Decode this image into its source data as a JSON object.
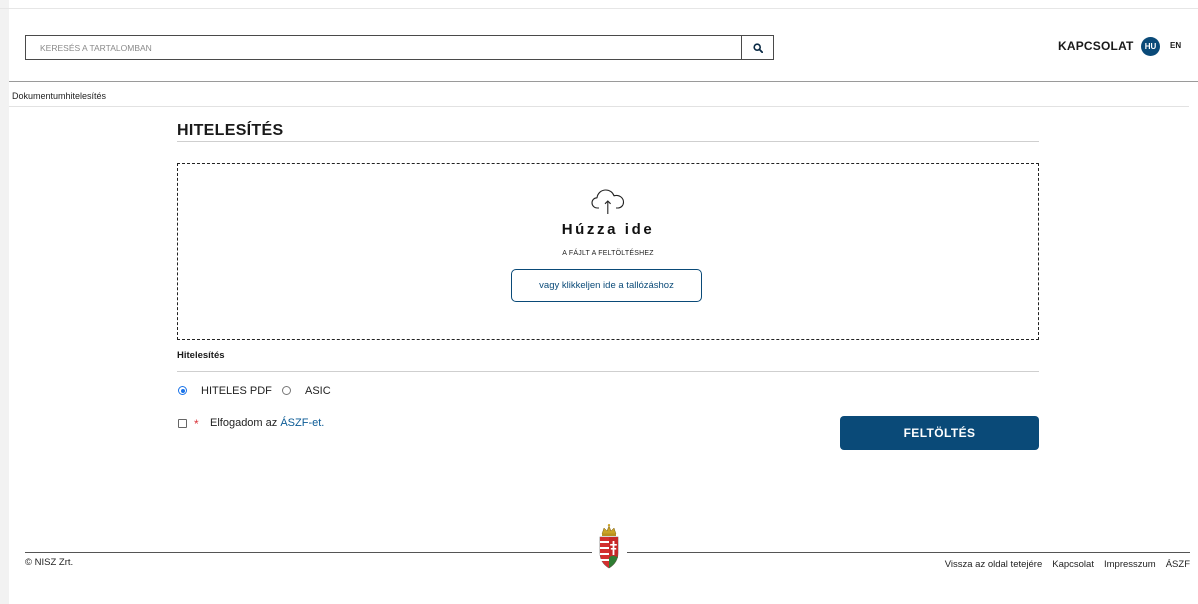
{
  "header": {
    "search_placeholder": "KERESÉS A TARTALOMBAN",
    "contact_label": "KAPCSOLAT",
    "lang_active": "HU",
    "lang_other": "EN"
  },
  "breadcrumb": "Dokumentumhitelesítés",
  "main": {
    "title": "HITELESÍTÉS",
    "dropzone": {
      "title": "Húzza ide",
      "subtitle": "A FÁJLT A FELTÖLTÉSHEZ",
      "browse_label": "vagy klikkeljen ide a tallózáshoz"
    },
    "section_label": "Hitelesítés",
    "options": [
      {
        "label": "HITELES PDF",
        "checked": true
      },
      {
        "label": "ASIC",
        "checked": false
      }
    ],
    "terms": {
      "required_mark": "*",
      "text": "Elfogadom az ",
      "link": "ÁSZF-et.",
      "checked": false
    },
    "upload_label": "FELTÖLTÉS"
  },
  "footer": {
    "copyright": "© NISZ Zrt.",
    "links": [
      "Vissza az oldal tetejére",
      "Kapcsolat",
      "Impresszum",
      "ÁSZF"
    ]
  },
  "colors": {
    "primary": "#0a4a78",
    "radio_accent": "#1a73e8",
    "required": "#d9343a",
    "link": "#0a5a95"
  },
  "icons": {
    "search": "magnifier",
    "upload": "cloud-upload",
    "coat_of_arms": "hungarian-coat-of-arms"
  }
}
